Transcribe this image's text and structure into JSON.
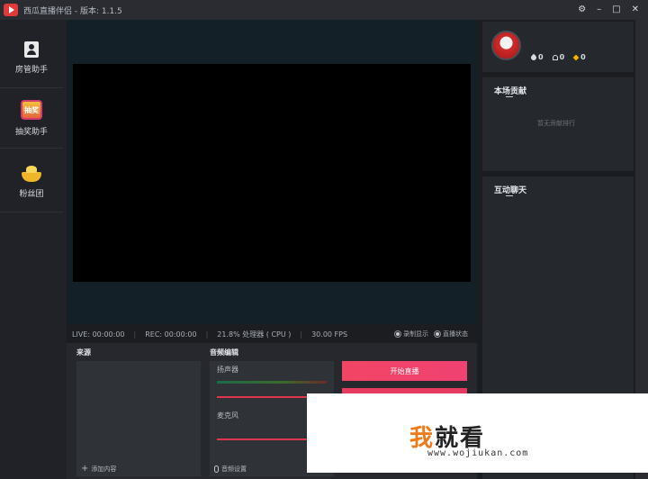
{
  "window": {
    "title": "西瓜直播伴侣 - 版本: 1.1.5",
    "controls": [
      "⚙",
      "–",
      "□",
      "✕"
    ]
  },
  "sidebar": {
    "items": [
      {
        "label": "房管助手",
        "icon": "admin-icon"
      },
      {
        "label": "抽奖助手",
        "icon": "lottery-icon",
        "icon_text": "抽奖"
      },
      {
        "label": "粉丝团",
        "icon": "fan-club-icon"
      }
    ]
  },
  "status": {
    "live": "LIVE: 00:00:00",
    "rec": "REC: 00:00:00",
    "cpu": "21.8% 处理器 ( CPU )",
    "fps": "30.00 FPS",
    "toggle_record": "录制显示",
    "toggle_live": "直播状态"
  },
  "source": {
    "title": "来源",
    "add_label": "添加内容"
  },
  "audio": {
    "title": "音频编辑",
    "speaker_label": "扬声器",
    "mic_label": "麦克风",
    "settings_label": "音频设置"
  },
  "actions": {
    "start_live": "开始直播"
  },
  "profile": {
    "stat_fire": "0",
    "stat_fans": "0",
    "stat_gems": "0"
  },
  "contribution": {
    "title": "本场贡献",
    "empty": "暂无贡献排行"
  },
  "chat": {
    "title": "互动聊天"
  },
  "watermark": {
    "first": "我",
    "rest": "就看",
    "url": "www.wojiukan.com"
  },
  "colors": {
    "accent": "#f24565",
    "background": "#1b1d21",
    "preview": "#000000"
  }
}
